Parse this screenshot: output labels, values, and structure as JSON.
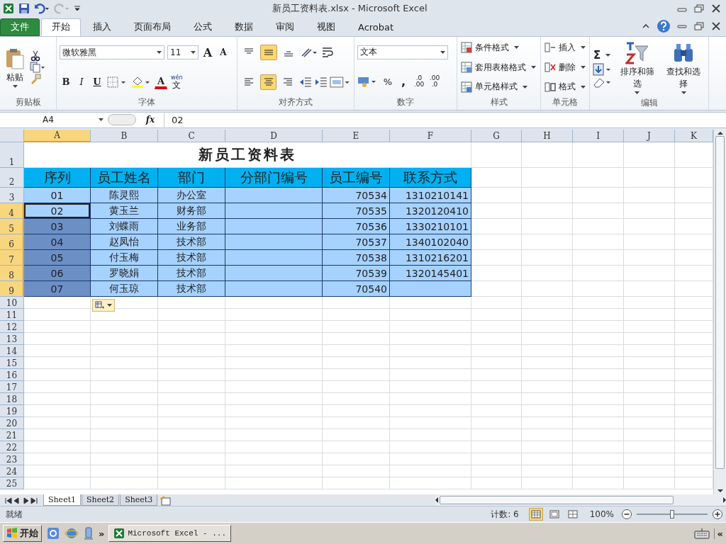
{
  "window": {
    "title": "新员工资料表.xlsx  -  Microsoft Excel"
  },
  "ribbon_tabs": [
    {
      "label": "文件",
      "kind": "file",
      "selected": false
    },
    {
      "label": "开始",
      "kind": "tab",
      "selected": true
    },
    {
      "label": "插入",
      "kind": "tab",
      "selected": false
    },
    {
      "label": "页面布局",
      "kind": "tab",
      "selected": false
    },
    {
      "label": "公式",
      "kind": "tab",
      "selected": false
    },
    {
      "label": "数据",
      "kind": "tab",
      "selected": false
    },
    {
      "label": "审阅",
      "kind": "tab",
      "selected": false
    },
    {
      "label": "视图",
      "kind": "tab",
      "selected": false
    },
    {
      "label": "Acrobat",
      "kind": "tab",
      "selected": false
    }
  ],
  "ribbon": {
    "clipboard": {
      "label": "剪贴板",
      "paste": "粘贴"
    },
    "font": {
      "label": "字体",
      "font_name": "微软雅黑",
      "font_size": "11",
      "grow": "A",
      "shrink": "A",
      "styles": [
        "B",
        "I",
        "U"
      ],
      "font_color": "A",
      "phonetic_top": "wén",
      "phonetic_bottom": "文"
    },
    "alignment": {
      "label": "对齐方式",
      "vertical": [
        {
          "selected": false
        },
        {
          "selected": true
        },
        {
          "selected": false
        }
      ],
      "horizontal": [
        {
          "selected": false
        },
        {
          "selected": true
        },
        {
          "selected": false
        }
      ]
    },
    "number": {
      "label": "数字",
      "format": "文本",
      "percent": "%",
      "comma": ",",
      "increase_decimal": [
        ".0",
        ".00"
      ],
      "decrease_decimal": [
        ".00",
        ".0"
      ]
    },
    "styles": {
      "label": "样式",
      "items": [
        "条件格式",
        "套用表格格式",
        "单元格样式"
      ]
    },
    "cells": {
      "label": "单元格",
      "items": [
        "插入",
        "删除",
        "格式"
      ]
    },
    "editing": {
      "label": "编辑",
      "sum": "Σ",
      "sort": "排序和筛选",
      "find": "查找和选择"
    }
  },
  "formula_bar": {
    "name_box": "A4",
    "fx": "fx",
    "value": "02"
  },
  "sheet": {
    "columns": [
      {
        "label": "A",
        "selected": true
      },
      {
        "label": "B",
        "selected": false
      },
      {
        "label": "C",
        "selected": false
      },
      {
        "label": "D",
        "selected": false
      },
      {
        "label": "E",
        "selected": false
      },
      {
        "label": "F",
        "selected": false
      },
      {
        "label": "G",
        "selected": false
      },
      {
        "label": "H",
        "selected": false
      },
      {
        "label": "I",
        "selected": false
      },
      {
        "label": "J",
        "selected": false
      },
      {
        "label": "K",
        "selected": false
      }
    ],
    "rows": [
      {
        "number": "1",
        "kind": "title",
        "selected": false,
        "text": "新员工资料表"
      },
      {
        "number": "2",
        "kind": "header",
        "selected": false,
        "cells": {
          "A": "序列",
          "B": "员工姓名",
          "C": "部门",
          "D": "分部门编号",
          "E": "员工编号",
          "F": "联系方式"
        }
      },
      {
        "number": "3",
        "kind": "data",
        "selected": false,
        "active": false,
        "cells": {
          "A": "01",
          "B": "陈灵熙",
          "C": "办公室",
          "E": "70534",
          "F": "1310210141"
        }
      },
      {
        "number": "4",
        "kind": "data",
        "selected": true,
        "active": true,
        "cells": {
          "A": "02",
          "B": "黄玉兰",
          "C": "财务部",
          "E": "70535",
          "F": "1320120410"
        }
      },
      {
        "number": "5",
        "kind": "data",
        "selected": true,
        "active": false,
        "cells": {
          "A": "03",
          "B": "刘蝶雨",
          "C": "业务部",
          "E": "70536",
          "F": "1330210101"
        }
      },
      {
        "number": "6",
        "kind": "data",
        "selected": true,
        "active": false,
        "cells": {
          "A": "04",
          "B": "赵凤怡",
          "C": "技术部",
          "E": "70537",
          "F": "1340102040"
        }
      },
      {
        "number": "7",
        "kind": "data",
        "selected": true,
        "active": false,
        "cells": {
          "A": "05",
          "B": "付玉梅",
          "C": "技术部",
          "E": "70538",
          "F": "1310216201"
        }
      },
      {
        "number": "8",
        "kind": "data",
        "selected": true,
        "active": false,
        "cells": {
          "A": "06",
          "B": "罗晓娟",
          "C": "技术部",
          "E": "70539",
          "F": "1320145401"
        }
      },
      {
        "number": "9",
        "kind": "data",
        "selected": true,
        "active": false,
        "cells": {
          "A": "07",
          "B": "何玉琼",
          "C": "技术部",
          "E": "70540"
        }
      },
      {
        "number": "10",
        "kind": "empty",
        "selected": false
      },
      {
        "number": "11",
        "kind": "empty",
        "selected": false
      },
      {
        "number": "12",
        "kind": "empty",
        "selected": false
      },
      {
        "number": "13",
        "kind": "empty",
        "selected": false
      },
      {
        "number": "14",
        "kind": "empty",
        "selected": false
      },
      {
        "number": "15",
        "kind": "empty",
        "selected": false
      },
      {
        "number": "16",
        "kind": "empty",
        "selected": false
      },
      {
        "number": "17",
        "kind": "empty",
        "selected": false
      },
      {
        "number": "18",
        "kind": "empty",
        "selected": false
      },
      {
        "number": "19",
        "kind": "empty",
        "selected": false
      },
      {
        "number": "20",
        "kind": "empty",
        "selected": false
      },
      {
        "number": "21",
        "kind": "empty",
        "selected": false
      },
      {
        "number": "22",
        "kind": "empty",
        "selected": false
      },
      {
        "number": "23",
        "kind": "empty",
        "selected": false
      },
      {
        "number": "24",
        "kind": "empty",
        "selected": false
      },
      {
        "number": "25",
        "kind": "empty",
        "selected": false
      }
    ]
  },
  "sheet_tabs": [
    {
      "label": "Sheet1",
      "selected": true
    },
    {
      "label": "Sheet2",
      "selected": false
    },
    {
      "label": "Sheet3",
      "selected": false
    }
  ],
  "status_bar": {
    "ready": "就绪",
    "count": "计数: 6",
    "views": [
      {
        "selected": true
      },
      {
        "selected": false
      },
      {
        "selected": false
      }
    ],
    "zoom": "100%",
    "zoom_slider": {
      "level": 0.5
    }
  },
  "taskbar": {
    "start": "开始",
    "more": "»",
    "tasks": [
      {
        "label": "Microsoft Excel - ...",
        "selected": false
      }
    ],
    "collapse": "«"
  }
}
